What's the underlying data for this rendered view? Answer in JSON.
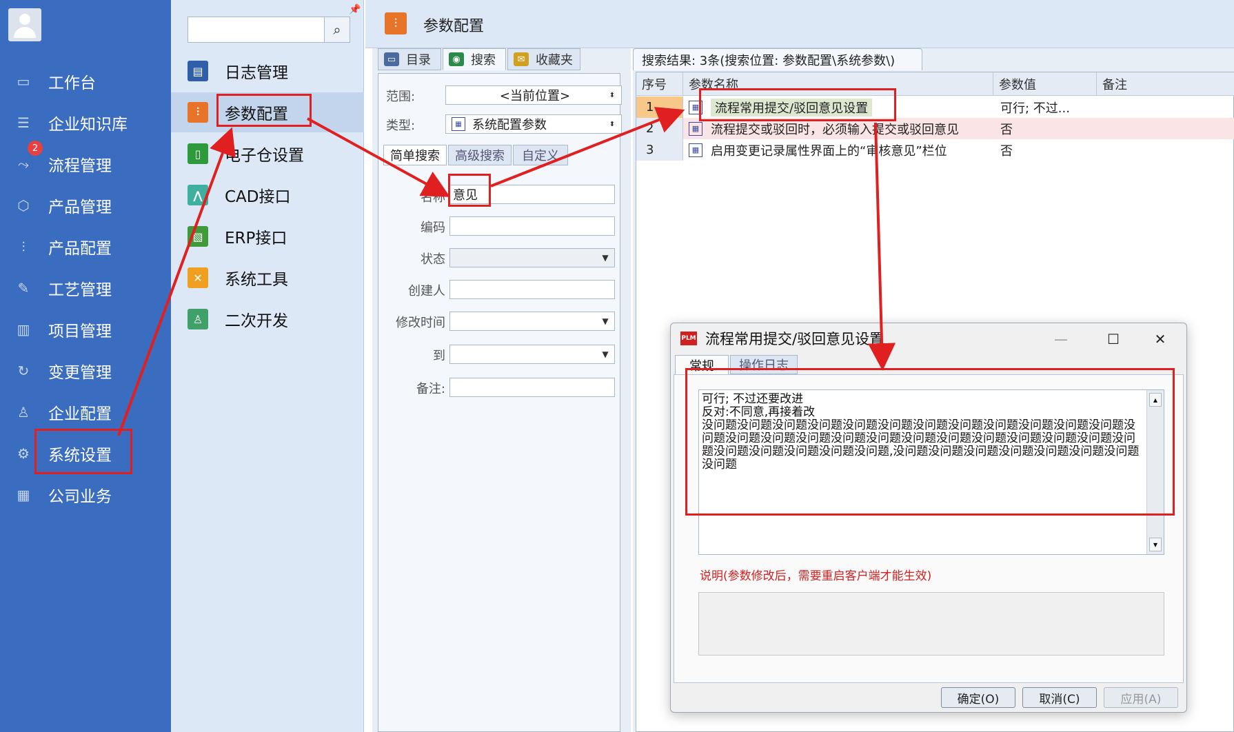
{
  "nav": {
    "items": [
      {
        "label": "工作台",
        "icon": "monitor-icon",
        "glyph": "▭"
      },
      {
        "label": "企业知识库",
        "icon": "list-icon",
        "glyph": "☰"
      },
      {
        "label": "流程管理",
        "icon": "flow-icon",
        "glyph": "⤳",
        "badge": "2"
      },
      {
        "label": "产品管理",
        "icon": "cube-icon",
        "glyph": "⬡"
      },
      {
        "label": "产品配置",
        "icon": "sliders-icon",
        "glyph": "⫶"
      },
      {
        "label": "工艺管理",
        "icon": "wrench-icon",
        "glyph": "✎"
      },
      {
        "label": "项目管理",
        "icon": "chart-icon",
        "glyph": "▥"
      },
      {
        "label": "变更管理",
        "icon": "change-icon",
        "glyph": "↻"
      },
      {
        "label": "企业配置",
        "icon": "users-icon",
        "glyph": "♙"
      },
      {
        "label": "系统设置",
        "icon": "gear-icon",
        "glyph": "⚙"
      },
      {
        "label": "公司业务",
        "icon": "grid-icon",
        "glyph": "▦"
      }
    ]
  },
  "submenu": {
    "search_icon": "⌕",
    "items": [
      {
        "label": "日志管理",
        "icon": "log-icon",
        "glyph": "▤",
        "color": "#2f5fa8"
      },
      {
        "label": "参数配置",
        "icon": "params-icon",
        "glyph": "⫶",
        "color": "#e8742a"
      },
      {
        "label": "电子仓设置",
        "icon": "vault-icon",
        "glyph": "▯",
        "color": "#2d9a3c"
      },
      {
        "label": "CAD接口",
        "icon": "cad-icon",
        "glyph": "⋀",
        "color": "#3fb0a0"
      },
      {
        "label": "ERP接口",
        "icon": "erp-icon",
        "glyph": "▧",
        "color": "#3f9a3a"
      },
      {
        "label": "系统工具",
        "icon": "tools-icon",
        "glyph": "✕",
        "color": "#f0a020"
      },
      {
        "label": "二次开发",
        "icon": "dev-icon",
        "glyph": "♙",
        "color": "#3fa06a"
      }
    ]
  },
  "header": {
    "title": "参数配置",
    "icon_glyph": "⫶"
  },
  "left_tabs": [
    {
      "label": "目录",
      "icon": "catalog-icon",
      "color": "#4a6aa0",
      "glyph": "▭"
    },
    {
      "label": "搜索",
      "icon": "search-globe-icon",
      "color": "#2a8a4a",
      "glyph": "◉"
    },
    {
      "label": "收藏夹",
      "icon": "favorites-icon",
      "color": "#d0a020",
      "glyph": "✉"
    }
  ],
  "filters": {
    "scope_label": "范围:",
    "scope_value": "<当前位置>",
    "type_label": "类型:",
    "type_value": "系统配置参数"
  },
  "search_tabs": [
    "简单搜索",
    "高级搜索",
    "自定义"
  ],
  "form": {
    "name_label": "名称",
    "name_value": "意见",
    "code_label": "编码",
    "status_label": "状态",
    "creator_label": "创建人",
    "modified_label": "修改时间",
    "to_label": "到",
    "remark_label": "备注:"
  },
  "results": {
    "tab_label": "搜索结果: 3条(搜索位置: 参数配置\\系统参数\\)",
    "columns": [
      "序号",
      "参数名称",
      "参数值",
      "备注"
    ],
    "rows": [
      {
        "no": "1",
        "name": "流程常用提交/驳回意见设置",
        "value": "可行; 不过..."
      },
      {
        "no": "2",
        "name": "流程提交或驳回时，必须输入提交或驳回意见",
        "value": "否"
      },
      {
        "no": "3",
        "name": "启用变更记录属性界面上的“审核意见”栏位",
        "value": "否"
      }
    ]
  },
  "dialog": {
    "logo": "PLM",
    "title": "流程常用提交/驳回意见设置",
    "minimize": "—",
    "maximize": "☐",
    "close": "✕",
    "tabs": [
      "常规",
      "操作日志"
    ],
    "text_line1": "可行; 不过还要改进",
    "text_line2": "反对:不同意,再接着改",
    "text_body": "没问题没问题没问题没问题没问题没问题没问题没问题没问题没问题没问题没问题没问题没问题没问题没问题没问题没问题没问题没问题没问题没问题没问题没问题没问题没问题没问题没问题没问题没问题,没问题没问题没问题没问题没问题没问题没问题没问题",
    "note": "说明(参数修改后，需要重启客户端才能生效)",
    "ok": "确定(O)",
    "cancel": "取消(C)",
    "apply": "应用(A)"
  },
  "colors": {
    "highlight": "#e02020",
    "nav_bg": "#3a6cc0"
  }
}
